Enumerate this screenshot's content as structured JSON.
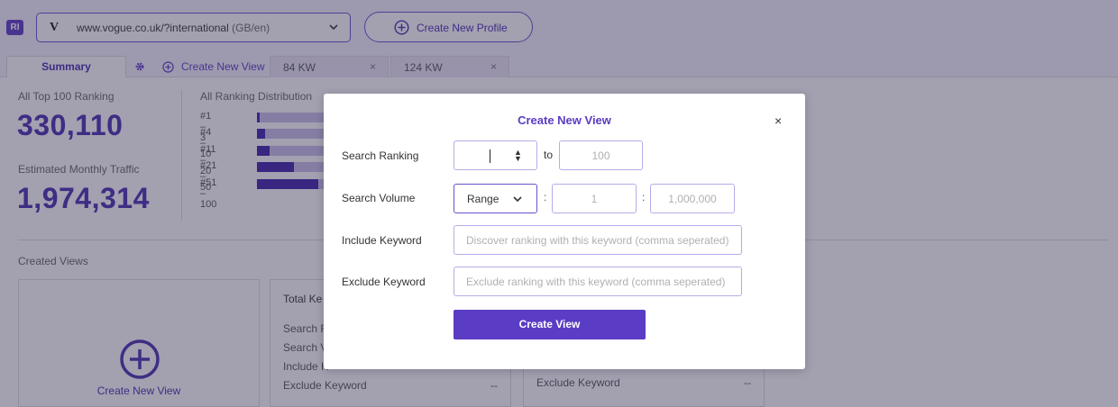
{
  "header": {
    "app_badge": "RI",
    "site_logo": "V",
    "site_url": "www.vogue.co.uk/?international",
    "site_locale": "(GB/en)",
    "create_profile_label": "Create New Profile"
  },
  "tabs": {
    "summary": "Summary",
    "create_view": "Create New View",
    "kw_tabs": [
      {
        "label": "84 KW",
        "close": "×"
      },
      {
        "label": "124 KW",
        "close": "×"
      }
    ]
  },
  "summary": {
    "top100_label": "All Top 100 Ranking",
    "top100_value": "330,110",
    "traffic_label": "Estimated Monthly Traffic",
    "traffic_value": "1,974,314",
    "distribution_title": "All Ranking Distribution",
    "distribution": [
      {
        "range": "#1 – 3",
        "fraction": 0.01
      },
      {
        "range": "#4 – 10",
        "fraction": 0.03
      },
      {
        "range": "#11 – 20",
        "fraction": 0.045
      },
      {
        "range": "#21 – 50",
        "fraction": 0.135
      },
      {
        "range": "#51 – 100",
        "fraction": 0.225
      }
    ]
  },
  "created_views": {
    "label": "Created Views",
    "new_view_label": "Create New View",
    "card_a": {
      "title": "Total Ke",
      "rows": [
        {
          "label": "Search R",
          "value": ""
        },
        {
          "label": "Search V",
          "value": ""
        },
        {
          "label": "Include K",
          "value": ""
        },
        {
          "label": "Exclude Keyword",
          "value": "--"
        }
      ]
    },
    "card_b": {
      "rows": [
        {
          "label": "Exclude Keyword",
          "value": "--"
        }
      ]
    }
  },
  "modal": {
    "title": "Create New View",
    "close": "×",
    "search_ranking_label": "Search Ranking",
    "rank_to_word": "to",
    "rank_to_placeholder": "100",
    "search_volume_label": "Search Volume",
    "volume_mode": "Range",
    "volume_min_placeholder": "1",
    "volume_max_placeholder": "1,000,000",
    "include_label": "Include Keyword",
    "include_placeholder": "Discover ranking with this keyword (comma seperated)",
    "exclude_label": "Exclude Keyword",
    "exclude_placeholder": "Exclude ranking with this keyword (comma seperated)",
    "submit_label": "Create View"
  },
  "colors": {
    "accent": "#5b3cc4",
    "bar_fill": "#3e22a8",
    "bar_track": "#c8bfe8"
  }
}
